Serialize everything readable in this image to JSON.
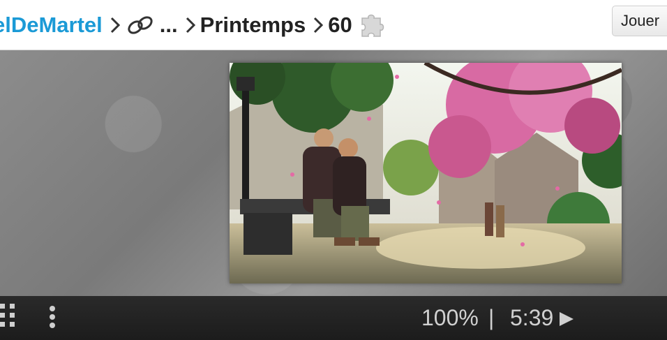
{
  "breadcrumb": {
    "author": "elDeMartel",
    "ellipsis": "...",
    "category": "Printemps",
    "piece_count": "60"
  },
  "header": {
    "play_button": "Jouer"
  },
  "toolbar": {
    "zoom": "100%",
    "separator": "|",
    "timer": "5:39"
  },
  "colors": {
    "link": "#1b9ad6",
    "toolbar": "#222222",
    "board": "#808080"
  },
  "icons": [
    "chevron-right-icon",
    "link-icon",
    "puzzle-icon",
    "grid-icon",
    "vertical-dots-icon",
    "play-icon"
  ]
}
